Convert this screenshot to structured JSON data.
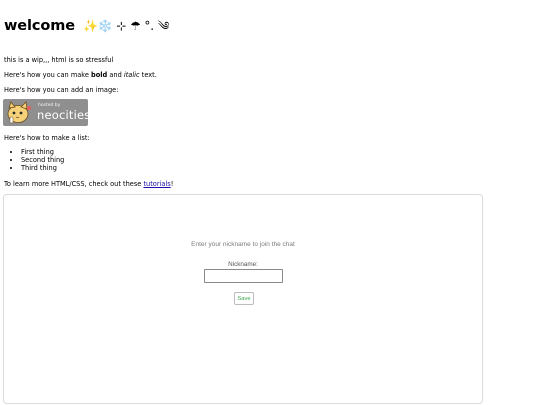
{
  "heading": {
    "text": "welcome",
    "decoration": "✨❄️ ⊹ ☂ °. ༄"
  },
  "intro": "this is a wip,,, html is so stressful",
  "formatting": {
    "prefix": "Here's how you can make ",
    "bold": "bold",
    "middle": " and ",
    "italic": "italic",
    "suffix": " text."
  },
  "image_intro": "Here's how you can add an image:",
  "badge": {
    "small": "hosted by",
    "brand": "neocities"
  },
  "list_intro": "Here's how to make a list:",
  "list_items": [
    "First thing",
    "Second thing",
    "Third thing"
  ],
  "learn": {
    "prefix": "To learn more HTML/CSS, check out these ",
    "link": "tutorials",
    "suffix": "!"
  },
  "chat": {
    "prompt": "Enter your nickname to join the chat",
    "nickname_label": "Nickname:",
    "nickname_value": "",
    "save_label": "Save"
  }
}
